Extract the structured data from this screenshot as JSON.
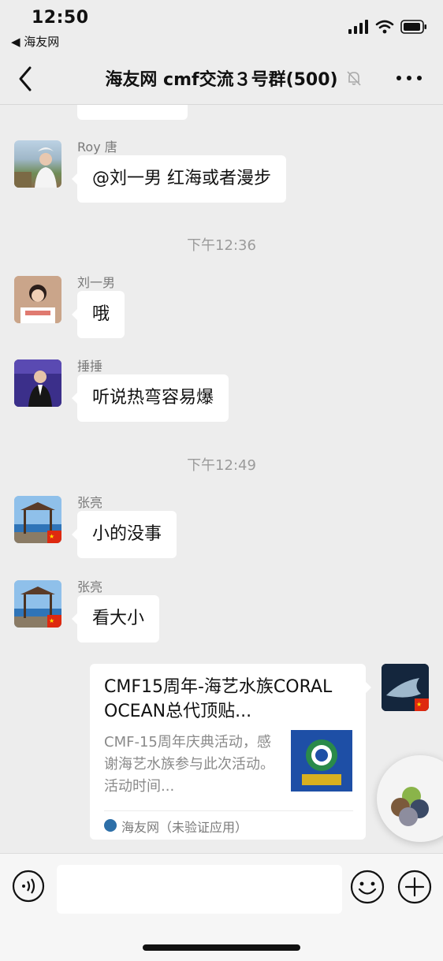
{
  "status_bar": {
    "time": "12:50",
    "back_label": "◀ 海友网"
  },
  "nav": {
    "title": "海友网 cmf交流３号群(500)"
  },
  "messages": [
    {
      "sender": "Roy 唐",
      "text": "@刘一男 红海或者漫步"
    },
    {
      "sender": "刘一男",
      "text": "哦"
    },
    {
      "sender": "捶捶",
      "text": "听说热弯容易爆"
    },
    {
      "sender": "张亮",
      "text": "小的没事"
    },
    {
      "sender": "张亮",
      "text": "看大小"
    }
  ],
  "timestamps": [
    "下午12:36",
    "下午12:49"
  ],
  "card": {
    "title": "CMF15周年-海艺水族CORAL OCEAN总代顶贴...",
    "description": "CMF-15周年庆典活动，感谢海艺水族参与此次活动。活动时间...",
    "source": "海友网（未验证应用）"
  },
  "input": {
    "value": ""
  },
  "colors": {
    "background": "#ededed",
    "bubble": "#ffffff",
    "secondary_text": "#7a7a7a"
  }
}
